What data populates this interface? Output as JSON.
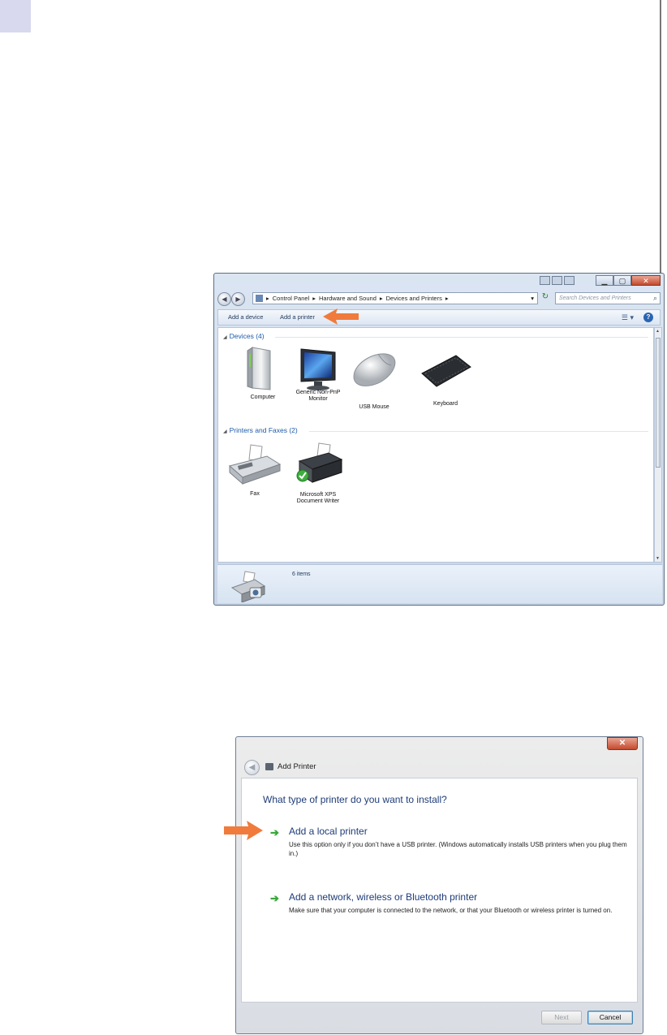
{
  "devices_window": {
    "address_bar": {
      "segments": [
        "Control Panel",
        "Hardware and Sound",
        "Devices and Printers"
      ]
    },
    "search": {
      "placeholder": "Search Devices and Printers"
    },
    "toolbar": {
      "add_device": "Add a device",
      "add_printer": "Add a printer"
    },
    "devices_group": {
      "title": "Devices (4)",
      "items": [
        {
          "label": "Computer",
          "icon": "computer-tower-icon"
        },
        {
          "label": "Generic Non-PnP Monitor",
          "icon": "monitor-icon"
        },
        {
          "label": "USB Mouse",
          "icon": "mouse-icon"
        },
        {
          "label": "Keyboard",
          "icon": "keyboard-icon"
        }
      ]
    },
    "printers_group": {
      "title": "Printers and Faxes (2)",
      "items": [
        {
          "label": "Fax",
          "icon": "fax-icon"
        },
        {
          "label": "Microsoft XPS Document Writer",
          "icon": "printer-icon",
          "default": true
        }
      ]
    },
    "status": {
      "count": "6 items"
    }
  },
  "add_printer_window": {
    "title": "Add Printer",
    "heading": "What type of printer do you want to install?",
    "options": [
      {
        "title": "Add a local printer",
        "description": "Use this option only if you don’t have a USB printer. (Windows automatically installs USB printers when you plug them in.)"
      },
      {
        "title": "Add a network, wireless or Bluetooth printer",
        "description": "Make sure that your computer is connected to the network, or that your Bluetooth or wireless printer is turned on."
      }
    ],
    "buttons": {
      "next": "Next",
      "cancel": "Cancel"
    }
  },
  "colors": {
    "callout": "#f07b3c",
    "link": "#1e3c78",
    "group": "#1e5aa8"
  }
}
